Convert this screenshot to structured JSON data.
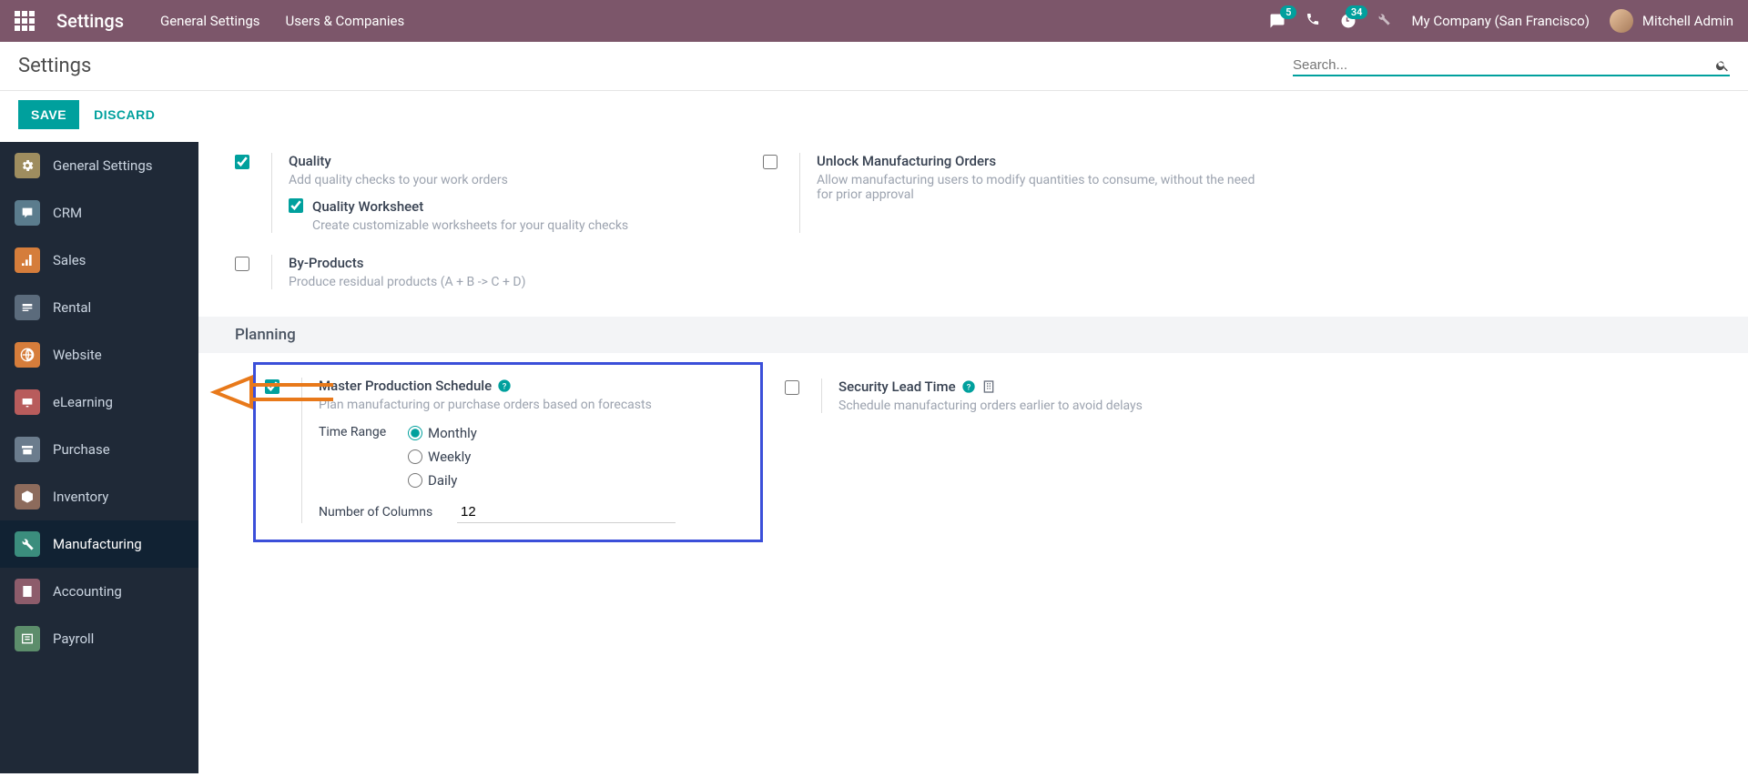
{
  "topbar": {
    "app_title": "Settings",
    "menu": [
      "General Settings",
      "Users & Companies"
    ],
    "msg_badge": "5",
    "act_badge": "34",
    "company": "My Company (San Francisco)",
    "user": "Mitchell Admin"
  },
  "ctrl": {
    "breadcrumb": "Settings",
    "search_placeholder": "Search...",
    "save": "SAVE",
    "discard": "DISCARD"
  },
  "sidebar": {
    "items": [
      "General Settings",
      "CRM",
      "Sales",
      "Rental",
      "Website",
      "eLearning",
      "Purchase",
      "Inventory",
      "Manufacturing",
      "Accounting",
      "Payroll"
    ],
    "active_index": 8
  },
  "settings": {
    "quality": {
      "title": "Quality",
      "desc": "Add quality checks to your work orders",
      "checked": true
    },
    "quality_ws": {
      "title": "Quality Worksheet",
      "desc": "Create customizable worksheets for your quality checks",
      "checked": true
    },
    "unlock_mo": {
      "title": "Unlock Manufacturing Orders",
      "desc": "Allow manufacturing users to modify quantities to consume, without the need for prior approval",
      "checked": false
    },
    "byproducts": {
      "title": "By-Products",
      "desc": "Produce residual products (A + B -> C + D)",
      "checked": false
    },
    "section_planning": "Planning",
    "mps": {
      "title": "Master Production Schedule",
      "desc": "Plan manufacturing or purchase orders based on forecasts",
      "checked": true,
      "time_range_label": "Time Range",
      "options": [
        "Monthly",
        "Weekly",
        "Daily"
      ],
      "selected_option": "Monthly",
      "num_cols_label": "Number of Columns",
      "num_cols_value": "12"
    },
    "sec_lead": {
      "title": "Security Lead Time",
      "desc": "Schedule manufacturing orders earlier to avoid delays",
      "checked": false
    }
  }
}
